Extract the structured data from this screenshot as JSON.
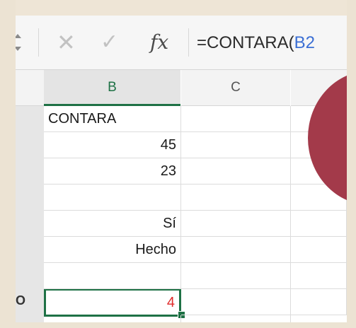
{
  "formula_bar": {
    "cancel_icon": "✕",
    "enter_icon": "✓",
    "fx_label": "fx",
    "formula_prefix": "=CONTARA(",
    "formula_ref": "B2"
  },
  "columns": [
    "B",
    "C"
  ],
  "selected_column": "B",
  "row_fragment": "O",
  "cells_b": [
    "CONTARA",
    "45",
    "23",
    "",
    "Sí",
    "Hecho",
    "4"
  ],
  "colors": {
    "accent_green": "#1e7145",
    "ref_blue": "#3b6fd4",
    "result_red": "#e02b2b",
    "circle": "#a33a4a"
  }
}
